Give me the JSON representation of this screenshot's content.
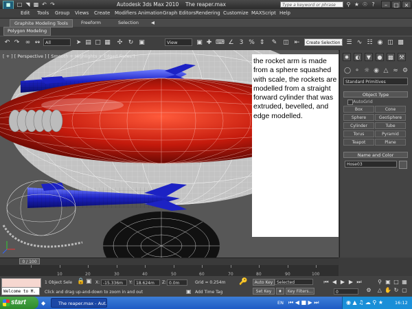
{
  "window": {
    "app_title": "Autodesk 3ds Max  2010",
    "file_name": "The reaper.max",
    "search_placeholder": "Type a keyword or phrase"
  },
  "menu": [
    "Edit",
    "Tools",
    "Group",
    "Views",
    "Create",
    "Modifiers",
    "Animation",
    "Graph Editors",
    "Rendering",
    "Customize",
    "MAXScript",
    "Help"
  ],
  "ribbon": {
    "tabs": [
      "Graphite Modeling Tools",
      "Freeform",
      "Selection"
    ],
    "subtab": "Polygon Modeling"
  },
  "toolbar": {
    "selection_filter": "All",
    "ref_coord": "View",
    "snap_number": "3",
    "named_selection": "Create Selection Se"
  },
  "viewport": {
    "label": "[ + ] [ Perspective ] [ Smooth + Highlights + Edged Faces ]",
    "annotation": "the rocket arm is made from a sphere squashed with scale, the rockets are modelled from a straight forward cylinder that was extruded, bevelled, and edge modelled."
  },
  "command_panel": {
    "dropdown": "Standard Primitives",
    "object_type_header": "Object Type",
    "autogrid": "AutoGrid",
    "buttons": [
      "Box",
      "Cone",
      "Sphere",
      "GeoSphere",
      "Cylinder",
      "Tube",
      "Torus",
      "Pyramid",
      "Teapot",
      "Plane"
    ],
    "name_header": "Name and Color",
    "object_name": "Hose03"
  },
  "timeline": {
    "slider_label": "0 / 100",
    "ticks": [
      "10",
      "20",
      "30",
      "40",
      "50",
      "60",
      "70",
      "80",
      "90",
      "100"
    ]
  },
  "status": {
    "maxscript_listener": "Welcome to M.",
    "selection_count": "1 Object Sele",
    "prompt": "Click and drag up-and-down to zoom in and out",
    "x_label": "X:",
    "x_value": "-15.336m",
    "y_label": "Y:",
    "y_value": "18.624m",
    "z_label": "Z:",
    "z_value": "0.0m",
    "grid": "Grid = 0.254m",
    "add_time_tag": "Add Time Tag",
    "auto_key": "Auto Key",
    "set_key": "Set Key",
    "key_mode": "Selected",
    "key_filters": "Key Filters...",
    "frame": "0"
  },
  "taskbar": {
    "start": "start",
    "task": "The reaper.max - Aut...",
    "language": "EN",
    "clock": "16:12"
  },
  "colors": {
    "annotation_bg": "#ffffff",
    "taskbar_blue": "#245edb",
    "start_green": "#3a9a38",
    "hull_red": "#c41a0c",
    "rocket_blue": "#1c22c4"
  }
}
